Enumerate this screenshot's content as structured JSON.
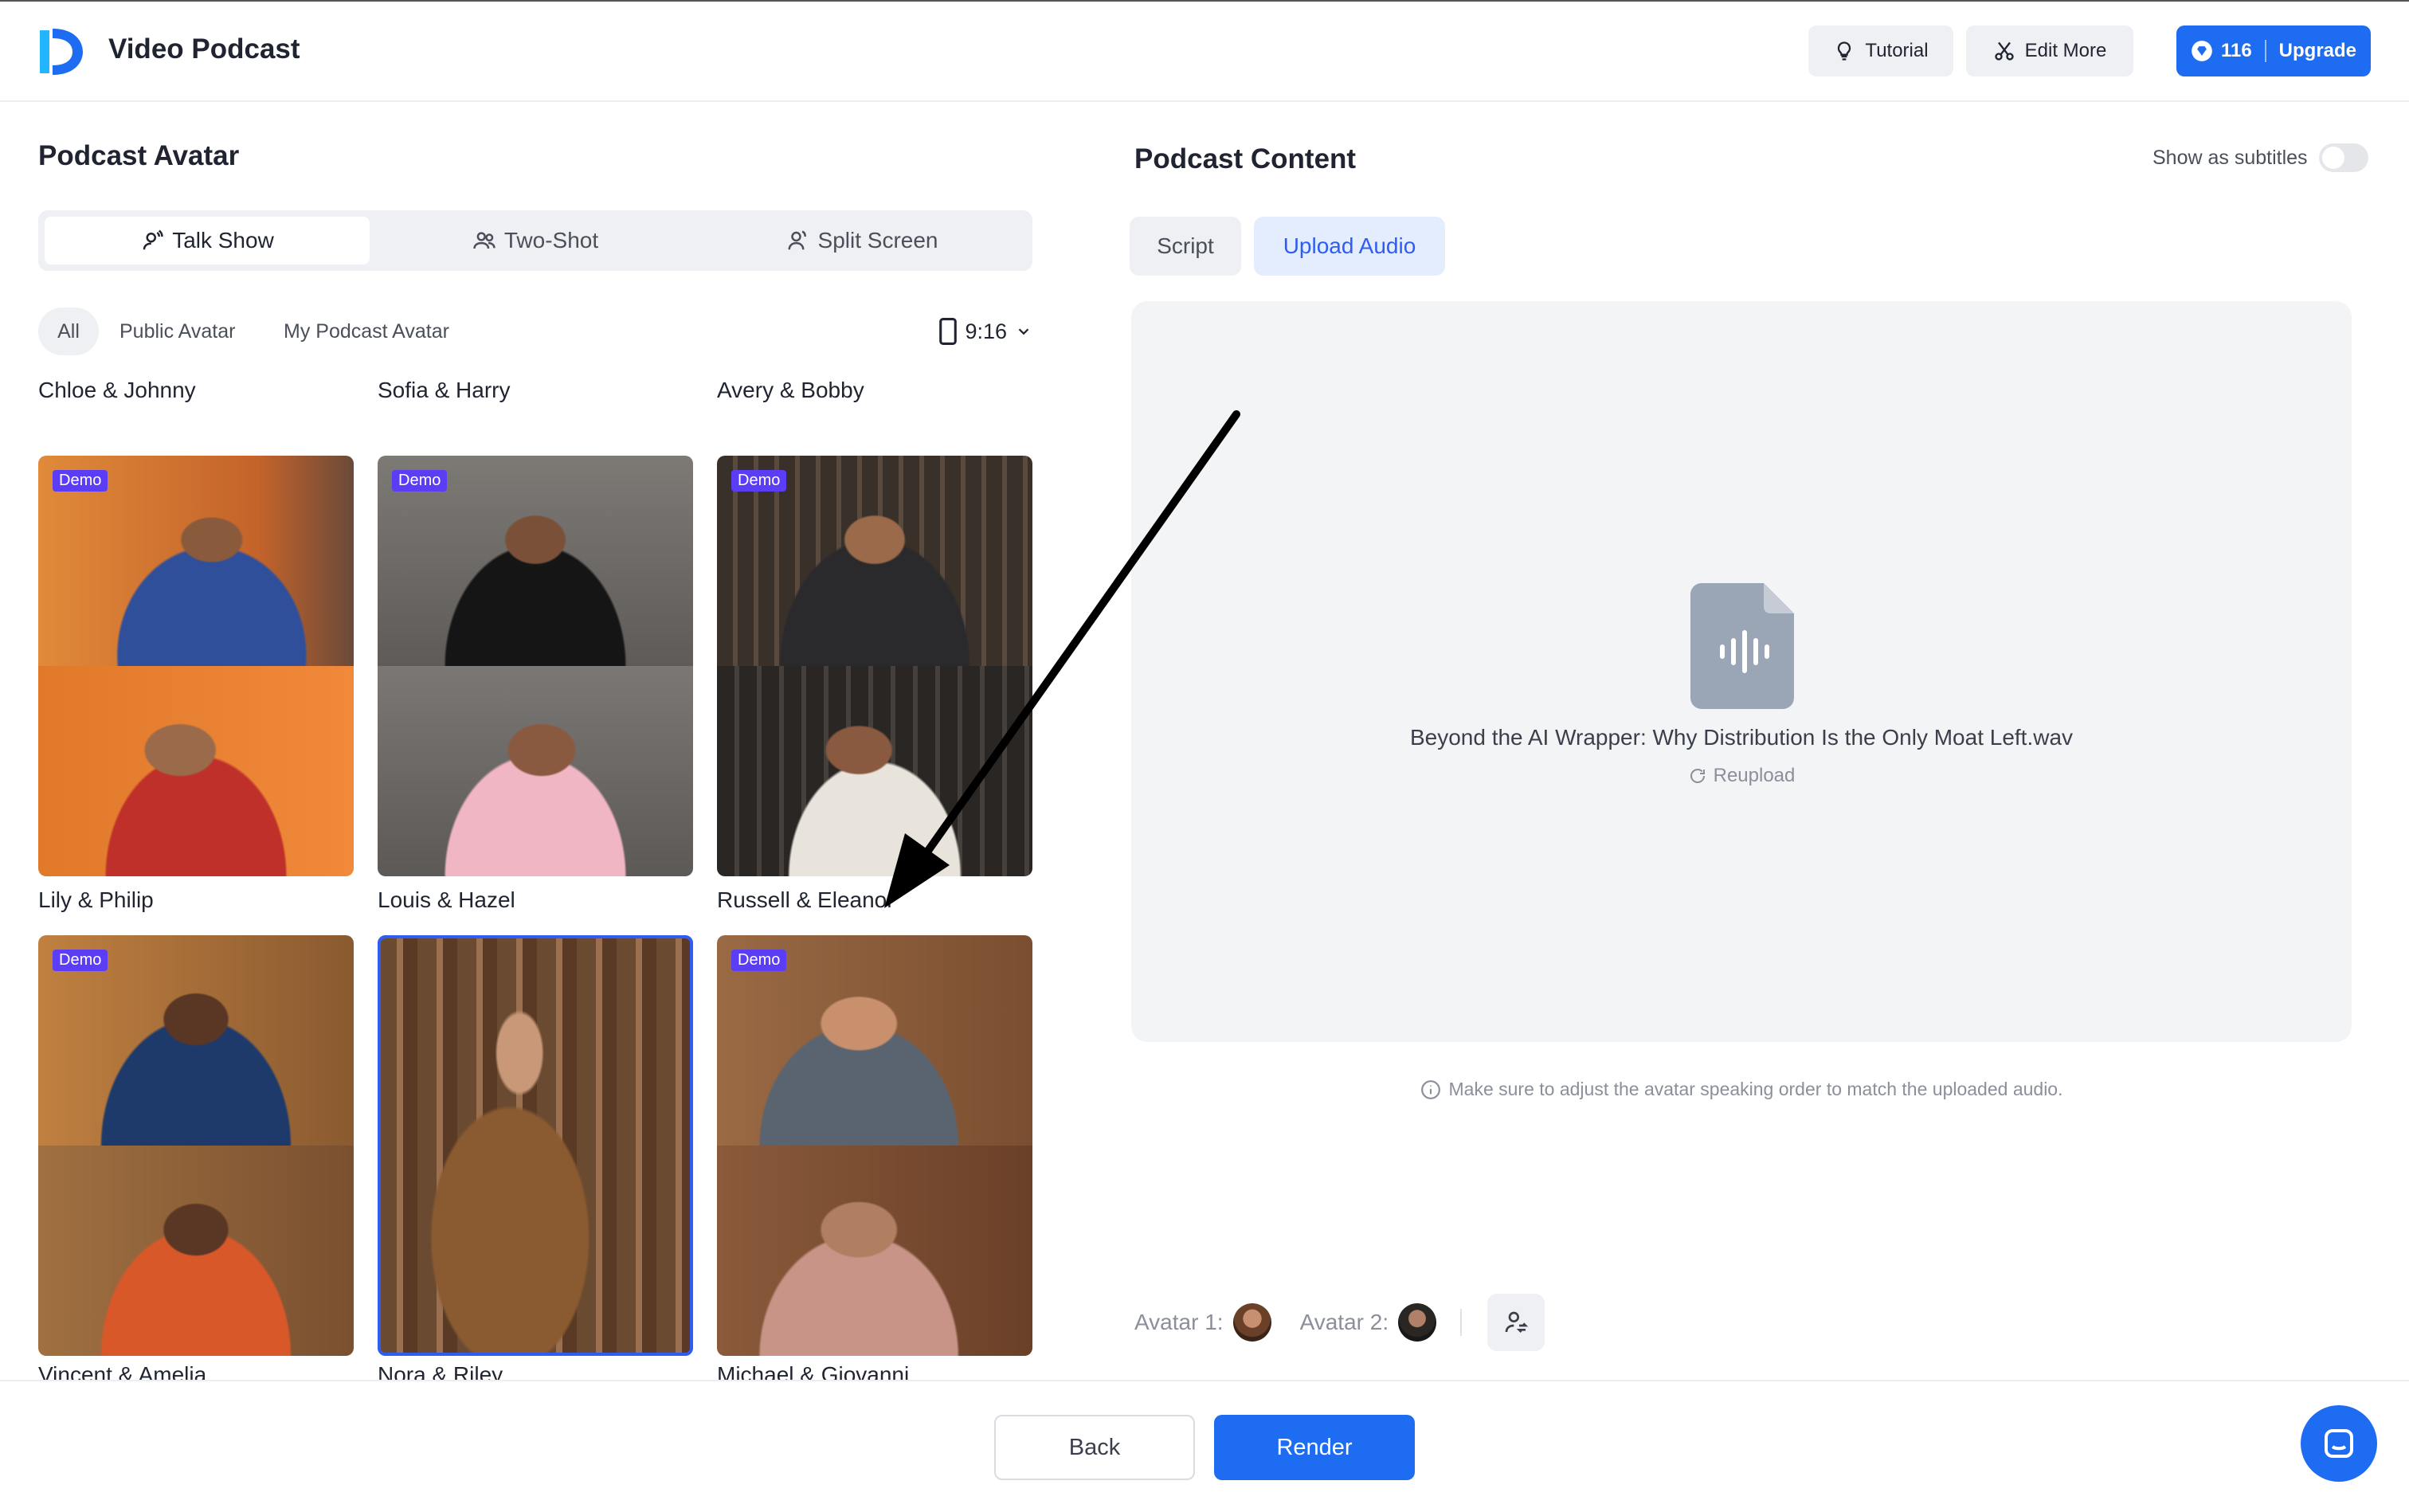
{
  "header": {
    "title": "Video Podcast",
    "tutorial_label": "Tutorial",
    "edit_more_label": "Edit More",
    "credits": "116",
    "upgrade_label": "Upgrade"
  },
  "left": {
    "title": "Podcast Avatar",
    "layout_tabs": [
      "Talk Show",
      "Two-Shot",
      "Split Screen"
    ],
    "active_layout": "Talk Show",
    "filters": [
      "All",
      "Public Avatar",
      "My Podcast Avatar"
    ],
    "active_filter": "All",
    "aspect_ratio": "9:16",
    "demo_badge": "Demo",
    "avatars": [
      {
        "name": "Chloe & Johnny"
      },
      {
        "name": "Sofia & Harry"
      },
      {
        "name": "Avery & Bobby"
      },
      {
        "name": "Lily & Philip",
        "demo": true
      },
      {
        "name": "Louis & Hazel",
        "demo": true
      },
      {
        "name": "Russell & Eleanor",
        "demo": true
      },
      {
        "name": "Vincent & Amelia",
        "demo": true
      },
      {
        "name": "Nora & Riley",
        "demo": false,
        "selected": true
      },
      {
        "name": "Michael & Giovanni",
        "demo": true
      }
    ]
  },
  "right": {
    "title": "Podcast Content",
    "subtitles_label": "Show as subtitles",
    "subtitles_on": false,
    "tabs": [
      "Script",
      "Upload Audio"
    ],
    "active_tab": "Upload Audio",
    "file_name": "Beyond the AI Wrapper: Why Distribution Is the Only Moat Left.wav",
    "reupload_label": "Reupload",
    "note": "Make sure to adjust the avatar speaking order to match the uploaded audio.",
    "avatar1_label": "Avatar 1:",
    "avatar2_label": "Avatar 2:"
  },
  "footer": {
    "back_label": "Back",
    "render_label": "Render"
  },
  "colors": {
    "primary": "#1d6cf2",
    "demo_badge": "#5b3df5",
    "selected_outline": "#2f5df3"
  }
}
